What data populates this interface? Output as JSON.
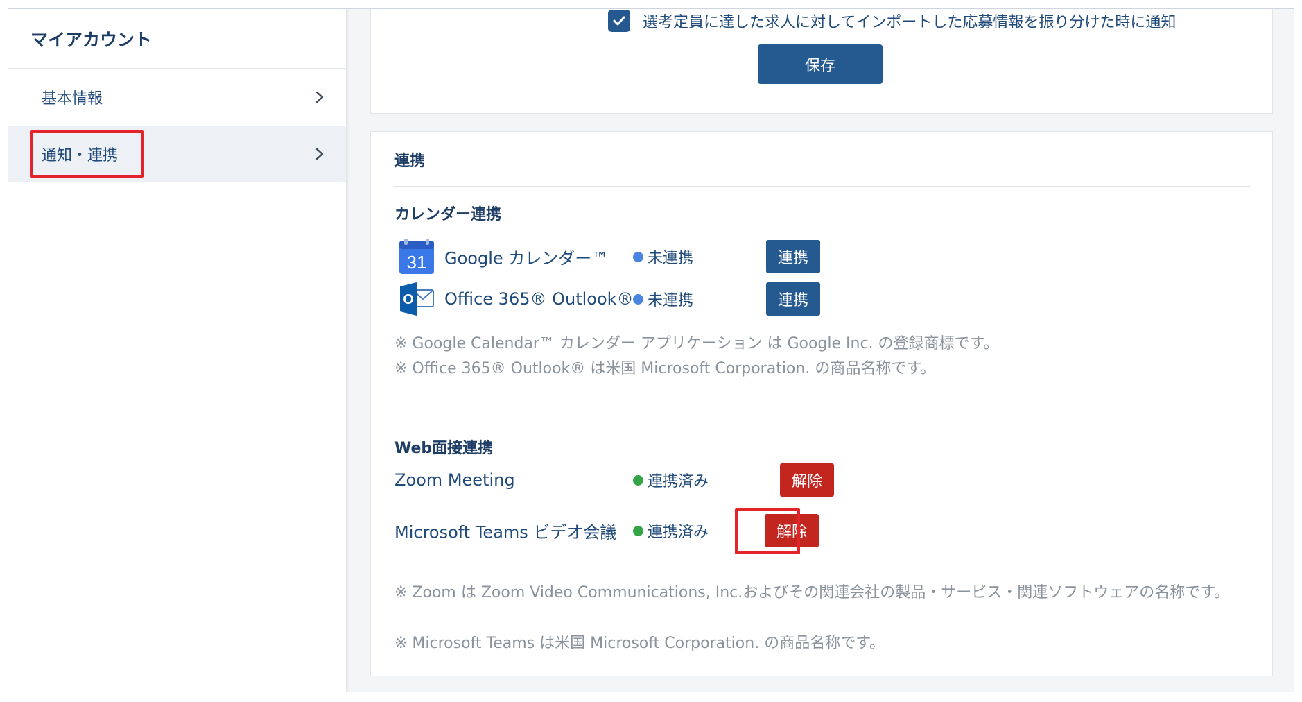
{
  "sidebar": {
    "title": "マイアカウント",
    "items": [
      {
        "label": "基本情報"
      },
      {
        "label": "通知・連携"
      }
    ]
  },
  "top_card": {
    "checkbox_label": "選考定員に達した求人に対してインポートした応募情報を振り分けた時に通知",
    "checkbox_checked": true,
    "save_label": "保存"
  },
  "integration": {
    "title": "連携",
    "calendar": {
      "title": "カレンダー連携",
      "services": [
        {
          "name": "Google カレンダー™",
          "icon": "google-calendar-icon",
          "icon_text": "31",
          "status": "未連携",
          "button": "連携"
        },
        {
          "name": "Office 365® Outlook®",
          "icon": "outlook-icon",
          "icon_text": "O",
          "status": "未連携",
          "button": "連携"
        }
      ],
      "notes": [
        "※ Google Calendar™ カレンダー アプリケーション は Google Inc. の登録商標です。",
        "※ Office 365® Outlook® は米国 Microsoft Corporation. の商品名称です。"
      ]
    },
    "web": {
      "title": "Web面接連携",
      "services": [
        {
          "name": "Zoom Meeting",
          "status": "連携済み",
          "button": "解除"
        },
        {
          "name": "Microsoft Teams ビデオ会議",
          "status": "連携済み",
          "button": "解除"
        }
      ],
      "notes": [
        "※ Zoom は Zoom Video Communications, Inc.およびその関連会社の製品・サービス・関連ソフトウェアの名称です。",
        "※ Microsoft Teams は米国 Microsoft Corporation. の商品名称です。"
      ]
    }
  },
  "colors": {
    "primary": "#255a91",
    "danger": "#c2261f",
    "highlight": "#e3242b",
    "status_unlinked": "#4a84e0",
    "status_linked": "#34a546"
  }
}
